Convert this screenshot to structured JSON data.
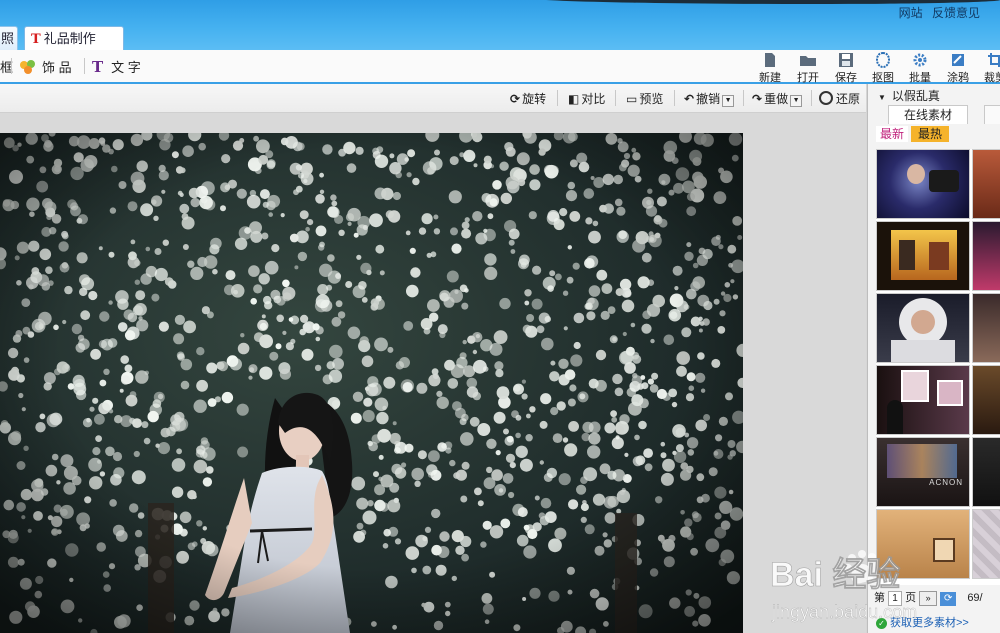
{
  "top_links": [
    "网站",
    "反馈意见"
  ],
  "tabs": {
    "photo": "照",
    "gift": "礼品制作"
  },
  "toolbar": {
    "left_items": [
      "框",
      "饰 品",
      "文 字"
    ],
    "right_tools": [
      "新建",
      "打开",
      "保存",
      "抠图",
      "批量",
      "涂鸦",
      "裁剪"
    ]
  },
  "edit_actions": {
    "rotate": "旋转",
    "compare": "对比",
    "preview": "预览",
    "undo": "撤销",
    "redo": "重做",
    "restore": "还原"
  },
  "panel": {
    "title": "以假乱真",
    "tab_online": "在线素材",
    "subtab_new": "最新",
    "subtab_hot": "最热",
    "pager_prefix": "第",
    "pager_page": "1",
    "pager_suffix": "页",
    "pager_count": "69/",
    "more_link": "获取更多素材>>"
  },
  "watermark": {
    "brand": "Bai 经验",
    "url": "jingyan.baidu.com"
  }
}
